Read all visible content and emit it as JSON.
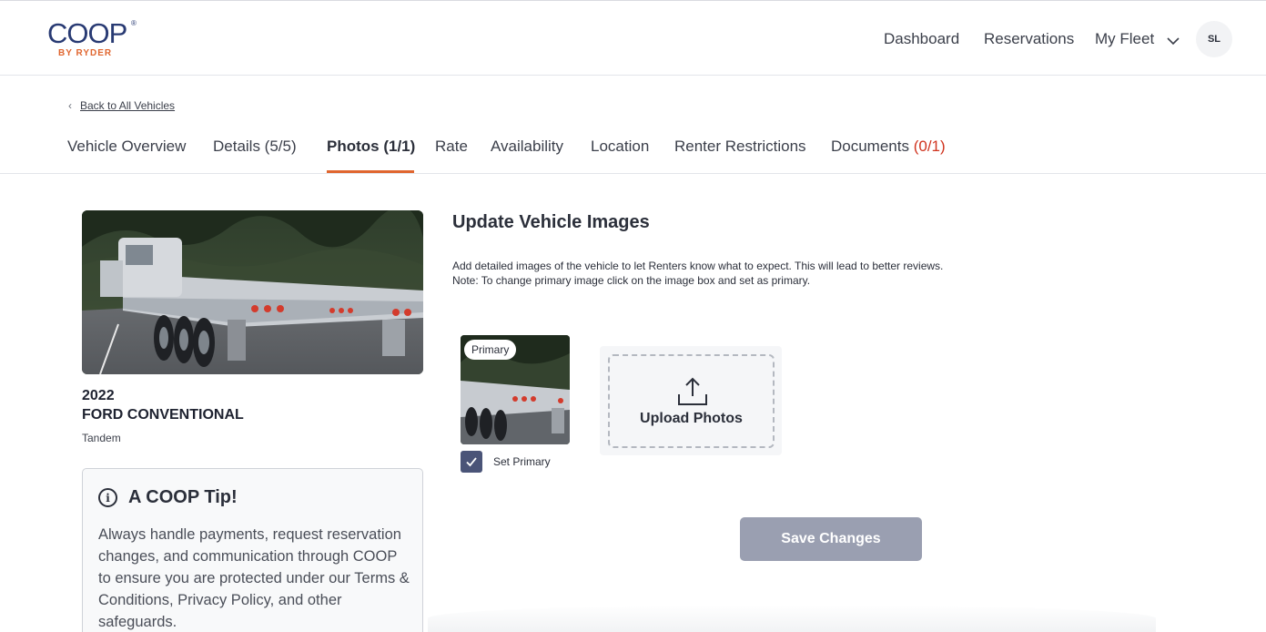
{
  "header": {
    "logo": {
      "word": "COOP",
      "sub": "BY RYDER",
      "reg": "®"
    },
    "nav": [
      {
        "label": "Dashboard"
      },
      {
        "label": "Reservations"
      },
      {
        "label": "My Fleet"
      }
    ],
    "avatar_initials": "SL"
  },
  "breadcrumb": {
    "label": "Back to All Vehicles"
  },
  "tabs": [
    {
      "label": "Vehicle Overview"
    },
    {
      "label": "Details (5/5)"
    },
    {
      "label": "Photos (1/1)",
      "active": true
    },
    {
      "label": "Rate"
    },
    {
      "label": "Availability"
    },
    {
      "label": "Location"
    },
    {
      "label": "Renter Restrictions"
    },
    {
      "label": "Documents",
      "count": "(0/1)"
    }
  ],
  "vehicle": {
    "year": "2022",
    "name": "FORD CONVENTIONAL",
    "subtype": "Tandem"
  },
  "tip": {
    "title": "A COOP Tip!",
    "body": "Always handle payments, request reservation changes, and communication through COOP to ensure you are protected under our Terms & Conditions, Privacy Policy, and other safeguards."
  },
  "images_section": {
    "title": "Update Vehicle Images",
    "desc_line1": "Add detailed images of the vehicle to let Renters know what to expect. This will lead to better reviews.",
    "desc_line2": "Note: To change primary image click on the image box and set as primary.",
    "primary_badge": "Primary",
    "set_primary_label": "Set Primary",
    "set_primary_checked": true,
    "upload_label": "Upload Photos",
    "save_label": "Save Changes"
  },
  "colors": {
    "accent": "#e0662f",
    "brand": "#283a73",
    "warning": "#d0341f",
    "button_disabled": "#9a9fb1",
    "checkbox": "#4a5478"
  }
}
